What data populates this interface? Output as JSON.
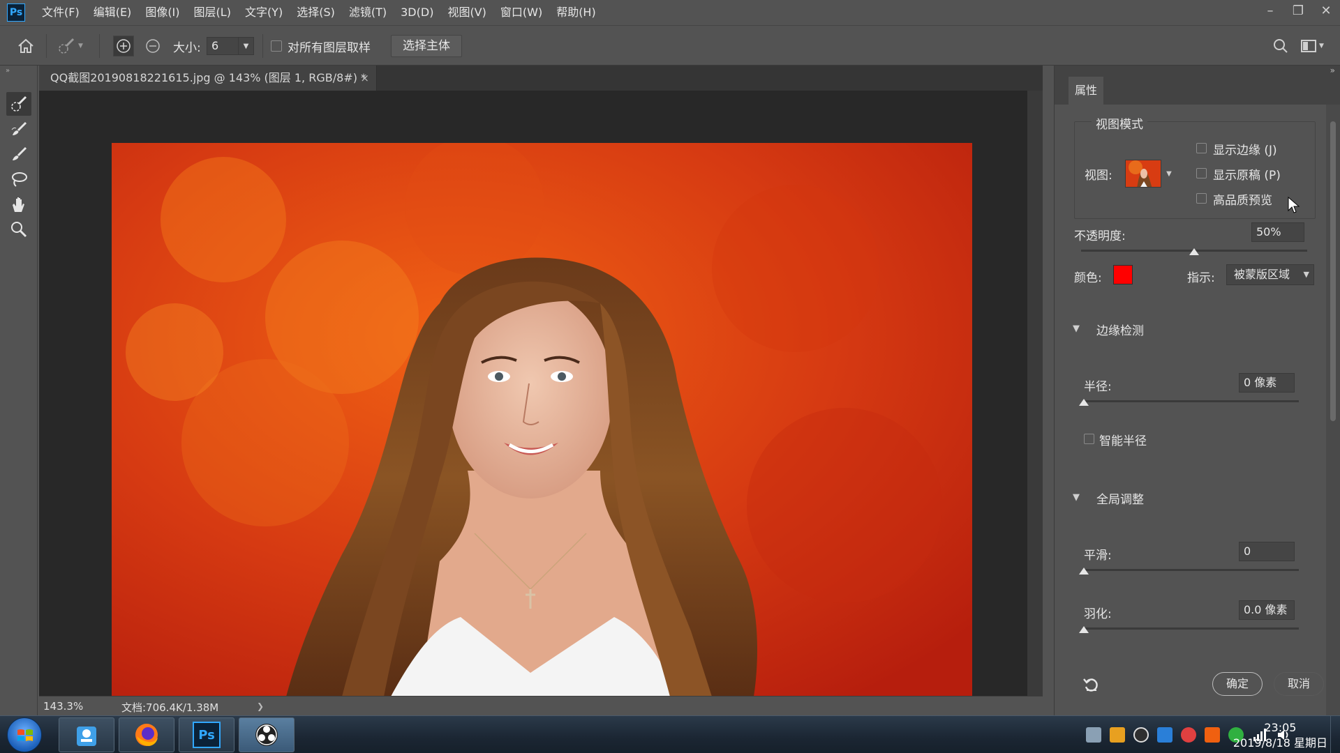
{
  "app": {
    "logo": "Ps"
  },
  "menu": [
    "文件(F)",
    "编辑(E)",
    "图像(I)",
    "图层(L)",
    "文字(Y)",
    "选择(S)",
    "滤镜(T)",
    "3D(D)",
    "视图(V)",
    "窗口(W)",
    "帮助(H)"
  ],
  "window_controls": {
    "minimize": "–",
    "restore": "❐",
    "close": "✕"
  },
  "options": {
    "size_label": "大小:",
    "size_value": "6",
    "sample_all_layers": "对所有图层取样",
    "select_subject": "选择主体"
  },
  "document": {
    "tab_title": "QQ截图20190818221615.jpg @ 143% (图层 1, RGB/8#) *",
    "tab_close": "×"
  },
  "status": {
    "zoom": "143.3%",
    "doc": "文档:706.4K/1.38M",
    "arrow": "❯"
  },
  "properties": {
    "tab": "属性",
    "view_mode": {
      "legend": "视图模式",
      "view_label": "视图:",
      "show_edge": "显示边缘 (J)",
      "show_original": "显示原稿 (P)",
      "high_quality": "高品质预览"
    },
    "opacity": {
      "label": "不透明度:",
      "value": "50%",
      "level_percent": 50
    },
    "color": {
      "label": "颜色:",
      "swatch": "#ff0000"
    },
    "indicate": {
      "label": "指示:",
      "value": "被蒙版区域"
    },
    "edge_detection": {
      "title": "边缘检测",
      "radius_label": "半径:",
      "radius_value": "0 像素",
      "smart_radius": "智能半径"
    },
    "global_refine": {
      "title": "全局调整",
      "smooth_label": "平滑:",
      "smooth_value": "0",
      "feather_label": "羽化:",
      "feather_value": "0.0 像素"
    },
    "ok": "确定",
    "cancel": "取消"
  },
  "taskbar": {
    "time": "23:05",
    "date": "2019/8/18 星期日"
  },
  "colors": {
    "accent": "#31a8ff",
    "overlay": "#ff0000"
  }
}
